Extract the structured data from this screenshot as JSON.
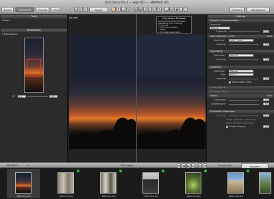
{
  "window": {
    "title": "DxO Optics Pro 6 — High-ISO — _MBP0941.JPG"
  },
  "toolbar": {
    "tabs": [
      "Select",
      "Customize",
      "Process",
      "View"
    ],
    "active_tab": "Customize",
    "apply_preset": "Apply preset",
    "palettes": "Palettes",
    "workspace": "Workspace"
  },
  "left": {
    "tools_title": "Tools",
    "tools_row": "Tools",
    "move_zoom_title": "Move/Zoom",
    "move_zoom_row": "Move/Zoom",
    "zoom_value": "1:1",
    "zoom_pct": "12%"
  },
  "viewer": {
    "before_label": "As shot",
    "preview_title": "Correction Preview",
    "preview_text": "Some factors within ISO area’s previewing of the following corrections:",
    "preview_items": [
      "• DxO Lens software",
      "• Noise",
      "• Chromatic aberration"
    ]
  },
  "right": {
    "settings_title": "Settings",
    "sections": {
      "exposure": "Exposure Compensation",
      "lighting": "DxO Lighting — 0.10",
      "vignetting": "Vignetting",
      "distortion": "Distortion",
      "lens_softness": "Lens softness",
      "unsharp": "Unsharp Mask",
      "noise": "Noise",
      "chroma": "Chromatic aberration"
    },
    "exposure_mode_label": "Correction",
    "exposure_mode": "Manual",
    "exposure_label": "Exposure",
    "exposure_value": "0.00",
    "lighting_label": "Correction",
    "lighting_mode": "Auto - Slight",
    "lighting_intensity_label": "Intensity",
    "lighting_value": "25",
    "vig_label": "Correction",
    "vig_mode": "Manual",
    "vig_intensity_label": "Intensity",
    "vig_value": "35",
    "dist_label": "Correction",
    "dist_mode": "Manual",
    "dist_type_label": "Type",
    "dist_type": "Barrel",
    "dist_intensity_label": "Intensity",
    "dist_value": "35",
    "keep_ratio": "Keep aspect ratio",
    "noise_lum_label": "Luminance",
    "noise_lum_value": "40",
    "noise_chroma_label": "Chrominance",
    "noise_chroma_value": "50",
    "auto_label": "Auto",
    "chroma_intensity_label": "Intensity",
    "chroma_intensity_value": "100",
    "chroma_line2": "Other chromatic aberration",
    "chroma_line3": "Blue chromatic aberration",
    "purple_fringing": "Purple fringing",
    "purple_value": "50"
  },
  "project": {
    "label": "PROJECT",
    "count": "116 images",
    "sort": "To new step",
    "process_button": "Process"
  },
  "filmstrip": [
    {
      "caption": "_MBP0941.JPG",
      "style": "sunset"
    },
    {
      "caption": "_MBP0101.JPG",
      "style": "bark"
    },
    {
      "caption": "_MBP0121.JPG",
      "style": "bark2"
    },
    {
      "caption": "_MBP0160.JPG",
      "style": "door"
    },
    {
      "caption": "_MBP0163.JPG",
      "style": "plant"
    },
    {
      "caption": "_MBP0166.JPG",
      "style": "building"
    },
    {
      "caption": "_MBP0170.JPG",
      "style": "tree"
    }
  ],
  "colors": {
    "accent": "#3a6fb0",
    "badge_green": "#32c040"
  }
}
